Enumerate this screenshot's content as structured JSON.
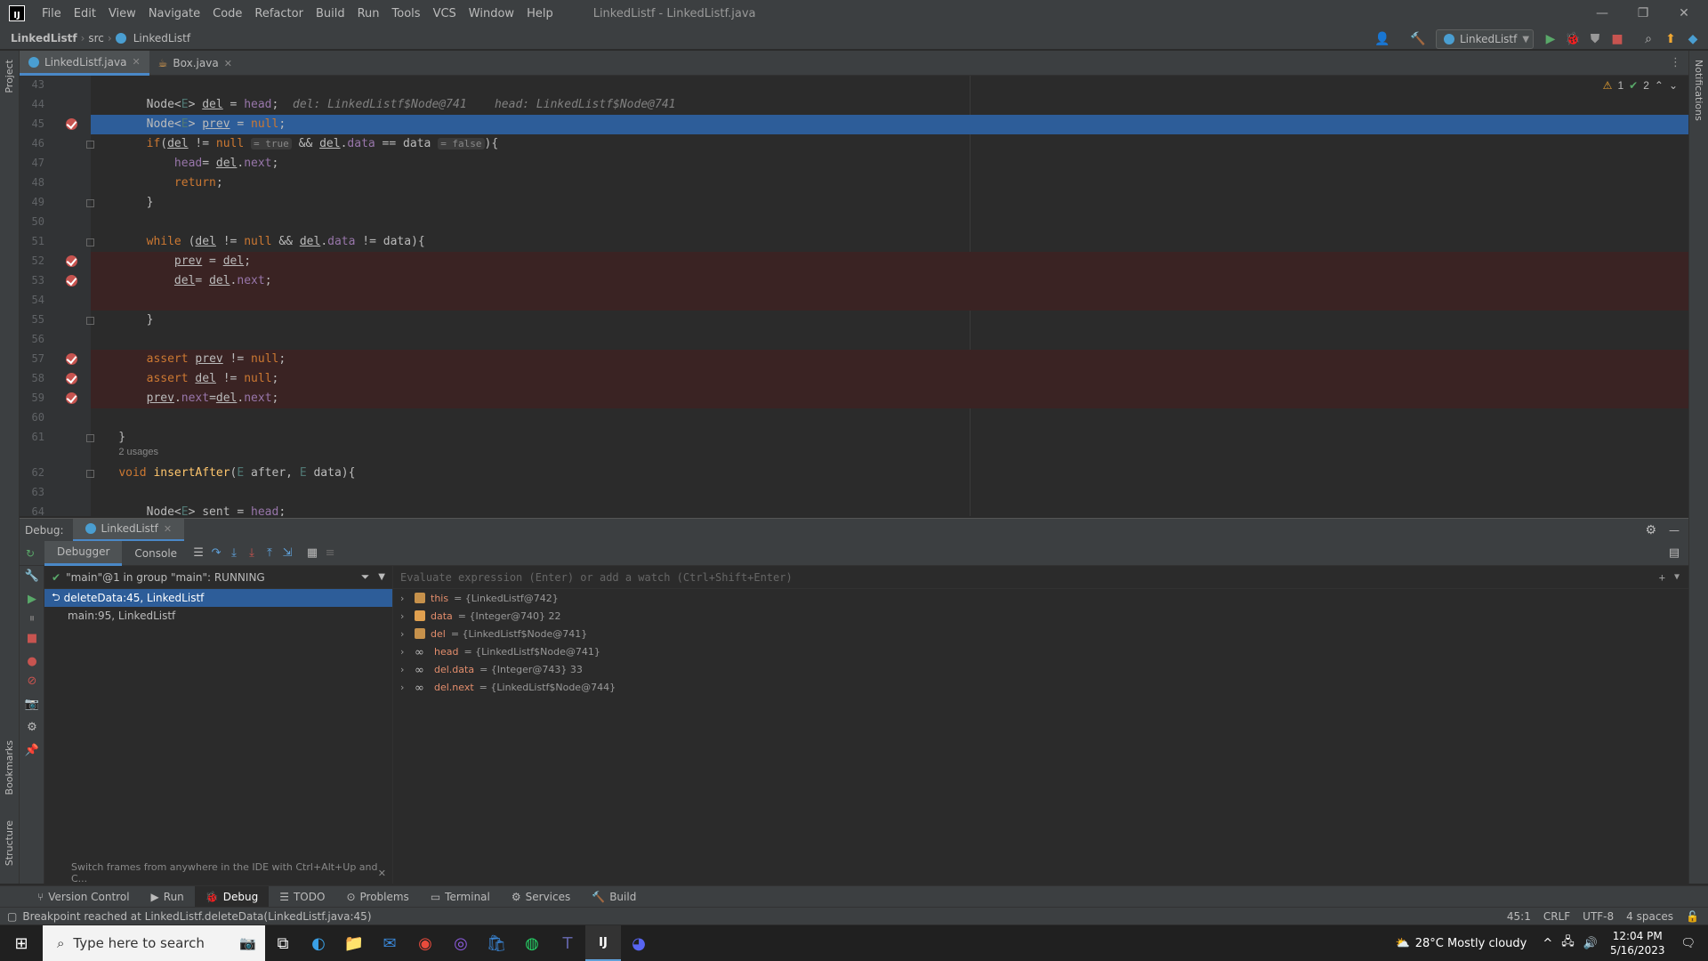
{
  "menu": [
    "File",
    "Edit",
    "View",
    "Navigate",
    "Code",
    "Refactor",
    "Build",
    "Run",
    "Tools",
    "VCS",
    "Window",
    "Help"
  ],
  "window_title": "LinkedListf - LinkedListf.java",
  "breadcrumb": {
    "project": "LinkedListf",
    "folder": "src",
    "file": "LinkedListf"
  },
  "run_config": "LinkedListf",
  "tabs": [
    {
      "label": "LinkedListf.java"
    },
    {
      "label": "Box.java"
    }
  ],
  "left_strip": {
    "project": "Project",
    "bookmarks": "Bookmarks",
    "structure": "Structure"
  },
  "right_strip": {
    "notifications": "Notifications"
  },
  "inspections": {
    "warnings": "1",
    "checks": "2"
  },
  "editor": {
    "lines": [
      {
        "n": "43"
      },
      {
        "n": "44"
      },
      {
        "n": "45"
      },
      {
        "n": "46"
      },
      {
        "n": "47"
      },
      {
        "n": "48"
      },
      {
        "n": "49"
      },
      {
        "n": "50"
      },
      {
        "n": "51"
      },
      {
        "n": "52"
      },
      {
        "n": "53"
      },
      {
        "n": "54"
      },
      {
        "n": "55"
      },
      {
        "n": "56"
      },
      {
        "n": "57"
      },
      {
        "n": "58"
      },
      {
        "n": "59"
      },
      {
        "n": "60"
      },
      {
        "n": "61"
      },
      {
        "n": "62"
      },
      {
        "n": "63"
      },
      {
        "n": "64"
      }
    ],
    "inline_44": "del: LinkedListf$Node@741    head: LinkedListf$Node@741",
    "hint_true": "= true",
    "hint_false": "= false",
    "usages": "2 usages"
  },
  "debug": {
    "label": "Debug:",
    "session": "LinkedListf",
    "tabs": [
      "Debugger",
      "Console"
    ],
    "thread": "\"main\"@1 in group \"main\": RUNNING",
    "frames": [
      "deleteData:45, LinkedListf",
      "main:95, LinkedListf"
    ],
    "tip": "Switch frames from anywhere in the IDE with Ctrl+Alt+Up and C...",
    "eval_placeholder": "Evaluate expression (Enter) or add a watch (Ctrl+Shift+Enter)",
    "variables": [
      {
        "name": "this",
        "value": "= {LinkedListf@742}",
        "icon": "field-icon"
      },
      {
        "name": "data",
        "value": "= {Integer@740} 22",
        "icon": "param-icon"
      },
      {
        "name": "del",
        "value": "= {LinkedListf$Node@741}",
        "icon": "field-icon"
      },
      {
        "name": "head",
        "value": "= {LinkedListf$Node@741}",
        "icon": "watch-icon"
      },
      {
        "name": "del.data",
        "value": "= {Integer@743} 33",
        "icon": "watch-icon"
      },
      {
        "name": "del.next",
        "value": "= {LinkedListf$Node@744}",
        "icon": "watch-icon"
      }
    ]
  },
  "bottom_tabs": [
    "Version Control",
    "Run",
    "Debug",
    "TODO",
    "Problems",
    "Terminal",
    "Services",
    "Build"
  ],
  "status": {
    "message": "Breakpoint reached at LinkedListf.deleteData(LinkedListf.java:45)",
    "position": "45:1",
    "line_sep": "CRLF",
    "encoding": "UTF-8",
    "indent": "4 spaces"
  },
  "taskbar": {
    "search_placeholder": "Type here to search",
    "weather": "28°C  Mostly cloudy",
    "time": "12:04 PM",
    "date": "5/16/2023"
  }
}
